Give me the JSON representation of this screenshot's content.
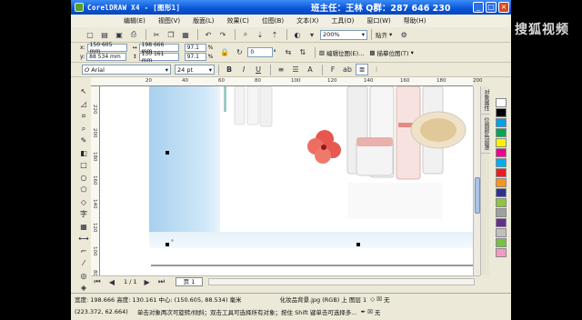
{
  "window": {
    "title": "CorelDRAW X4 - [图形1]",
    "banner": "班主任：王林  Q群：287 646 230"
  },
  "menu": [
    "编辑(E)",
    "视图(V)",
    "版面(L)",
    "效果(C)",
    "位图(B)",
    "文本(X)",
    "工具(O)",
    "窗口(W)",
    "帮助(H)"
  ],
  "toolbar1": {
    "zoom": "200%",
    "snap_label": "贴齐"
  },
  "toolbar2": {
    "x": "150 605 mm",
    "y": "88 534 mm",
    "width": "198 666 mm",
    "height": "130 161 mm",
    "scale_x": "97.1",
    "scale_y": "97.1",
    "percent_sign": "%",
    "rotation": "0",
    "degree": "°",
    "edit_bitmap": "编辑位图(E)...",
    "trace_bitmap": "描摹位图(T)"
  },
  "toolbar3": {
    "font": "Arial",
    "size": "24 pt"
  },
  "rulers": {
    "h_ticks": [
      "20",
      "40",
      "60",
      "80",
      "100",
      "120",
      "140",
      "160",
      "180",
      "200"
    ],
    "v_ticks": [
      "220",
      "200",
      "180",
      "160",
      "140",
      "120",
      "100",
      "80"
    ]
  },
  "page_nav": {
    "counter": "1 / 1",
    "tab": "页 1"
  },
  "dockers": [
    "对象属性",
    "位图颜色遮罩"
  ],
  "palette": [
    "#ffffff",
    "#000000",
    "#00a0e9",
    "#00a651",
    "#fff200",
    "#ec008c",
    "#00aeef",
    "#ed1c24",
    "#f7941d",
    "#2e3192",
    "#8dc63f",
    "#a0a0a0",
    "#662d91",
    "#c0c0c0",
    "#7ac143",
    "#f49ac2"
  ],
  "status": {
    "line1": "宽度: 198.666  高度: 130.161  中心: (150.605, 88.534)  毫米",
    "object_info": "化妆品背景.jpg (RGB) 上 图层 1",
    "fill_none": "无",
    "line2_coords": "(223.372, 62.664)",
    "line2_hint": "单击对象两次可旋转/倾斜；双击工具可选择所有对象；按住 Shift 键单击可选择多...",
    "outline_none": "无"
  },
  "watermark": "搜狐视频"
}
